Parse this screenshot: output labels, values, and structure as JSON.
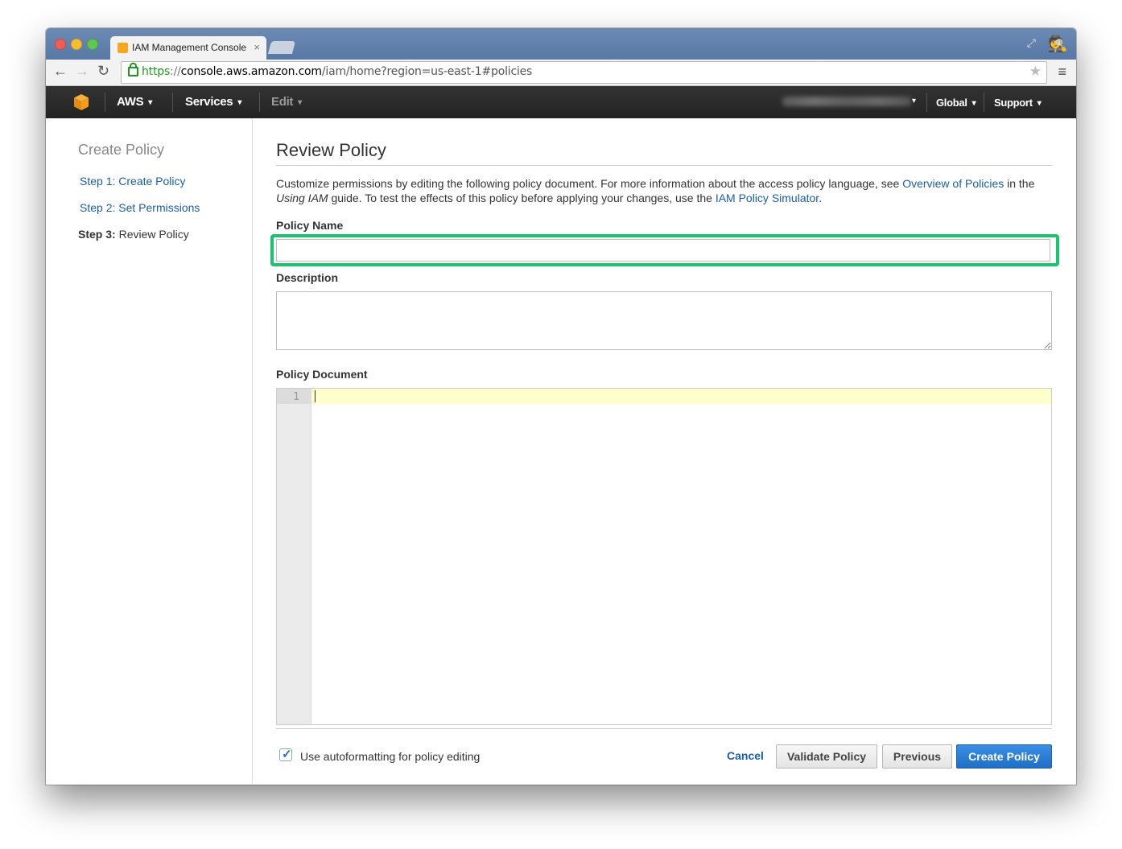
{
  "browser": {
    "tab_title": "IAM Management Console",
    "tab_close": "×",
    "url_scheme": "https",
    "url_sep": "://",
    "url_host": "console.aws.amazon.com",
    "url_path": "/iam/home?region=us-east-1#policies"
  },
  "aws_nav": {
    "aws_label": "AWS",
    "services_label": "Services",
    "edit_label": "Edit",
    "global_label": "Global",
    "support_label": "Support"
  },
  "sidebar": {
    "title": "Create Policy",
    "step1": "Step 1: Create Policy",
    "step2": "Step 2: Set Permissions",
    "step3_prefix": "Step 3:",
    "step3_label": "Review Policy"
  },
  "main": {
    "title": "Review Policy",
    "desc_part1": "Customize permissions by editing the following policy document. For more information about the access policy language, see ",
    "desc_link1": "Overview of Policies",
    "desc_part2": " in the ",
    "desc_italic": "Using IAM",
    "desc_part3": " guide. To test the effects of this policy before applying your changes, use the ",
    "desc_link2": "IAM Policy Simulator",
    "desc_part4": ".",
    "policy_name_label": "Policy Name",
    "policy_name_value": "",
    "description_label": "Description",
    "description_value": "",
    "policy_document_label": "Policy Document",
    "editor_line_number": "1",
    "autoformat_label": "Use autoformatting for policy editing",
    "autoformat_checked": true
  },
  "actions": {
    "cancel": "Cancel",
    "validate": "Validate Policy",
    "previous": "Previous",
    "create": "Create Policy"
  },
  "colors": {
    "link": "#1a5ea8",
    "primary_button": "#2f7fd8",
    "highlight": "#19c46d",
    "editor_active_line": "#ffffcc"
  }
}
